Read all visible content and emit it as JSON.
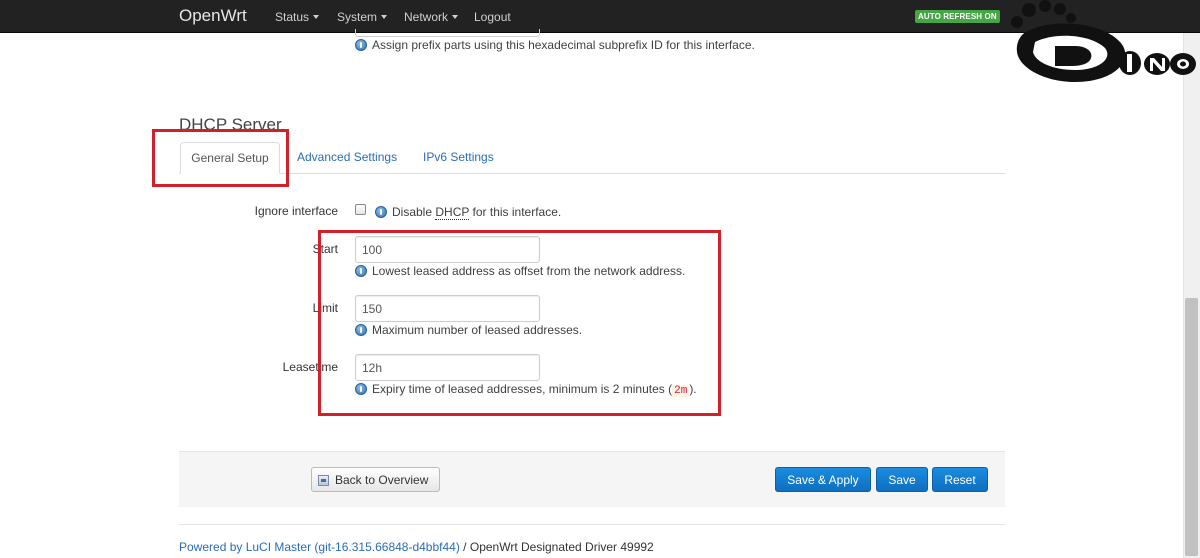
{
  "navbar": {
    "brand": "OpenWrt",
    "menu": [
      {
        "label": "Status"
      },
      {
        "label": "System"
      },
      {
        "label": "Network"
      },
      {
        "label": "Logout"
      }
    ],
    "auto_refresh": "AUTO REFRESH ON"
  },
  "logo": {
    "text": "DINO"
  },
  "prefix_hint": "Assign prefix parts using this hexadecimal subprefix ID for this interface.",
  "section_title": "DHCP Server",
  "tabs": [
    {
      "label": "General Setup",
      "active": true
    },
    {
      "label": "Advanced Settings",
      "active": false
    },
    {
      "label": "IPv6 Settings",
      "active": false
    }
  ],
  "form": {
    "ignore_interface": {
      "label": "Ignore interface",
      "checked": false,
      "hint_prefix": "Disable",
      "hint_abbr": "DHCP",
      "hint_suffix": "for this interface."
    },
    "start": {
      "label": "Start",
      "value": "100",
      "hint": "Lowest leased address as offset from the network address."
    },
    "limit": {
      "label": "Limit",
      "value": "150",
      "hint": "Maximum number of leased addresses."
    },
    "leasetime": {
      "label": "Leasetime",
      "value": "12h",
      "hint_prefix": "Expiry time of leased addresses, minimum is 2 minutes (",
      "hint_code": "2m",
      "hint_suffix": ")."
    }
  },
  "buttons": {
    "back": "Back to Overview",
    "save_apply": "Save & Apply",
    "save": "Save",
    "reset": "Reset"
  },
  "footer": {
    "link": "Powered by LuCI Master (git-16.315.66848-d4bbf44)",
    "separator": " / ",
    "text": "OpenWrt Designated Driver 49992"
  },
  "colors": {
    "navbar_bg": "#222222",
    "auto_refresh_badge": "#46a546",
    "link": "#2a6db5",
    "primary_button": "#1a8ce0",
    "annotation_red": "#d0202a"
  }
}
